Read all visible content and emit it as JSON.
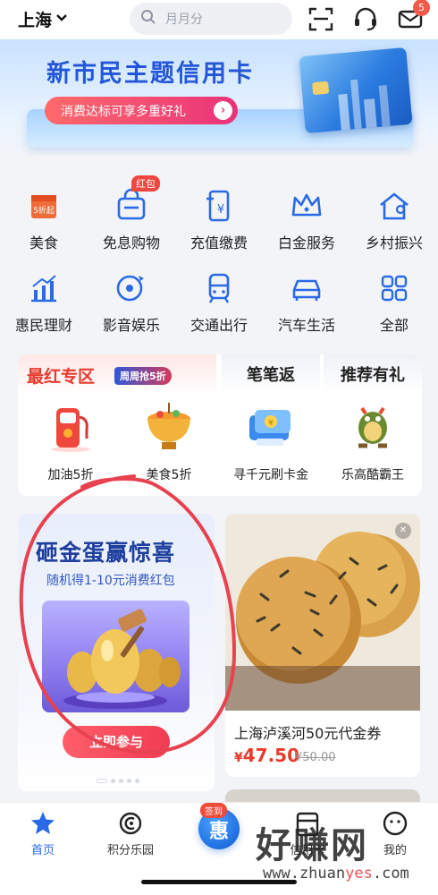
{
  "header": {
    "city": "上海",
    "search_placeholder": "月月分",
    "message_count": "5",
    "icons": [
      "chevron-down-icon",
      "search-icon",
      "scan-icon",
      "headset-icon",
      "mail-icon"
    ]
  },
  "banner": {
    "title": "新市民主题信用卡",
    "button": "消费达标可享多重好礼",
    "button_icon": "chevron-right-icon"
  },
  "grid": [
    {
      "label": "美食",
      "icon": "food-coupon-icon",
      "badge": "5折起"
    },
    {
      "label": "免息购物",
      "icon": "shopping-basket-icon",
      "badge": "红包"
    },
    {
      "label": "充值缴费",
      "icon": "recharge-icon"
    },
    {
      "label": "白金服务",
      "icon": "crown-icon"
    },
    {
      "label": "乡村振兴",
      "icon": "village-house-icon"
    },
    {
      "label": "惠民理财",
      "icon": "finance-chart-icon"
    },
    {
      "label": "影音娱乐",
      "icon": "media-icon"
    },
    {
      "label": "交通出行",
      "icon": "train-icon"
    },
    {
      "label": "汽车生活",
      "icon": "car-icon"
    },
    {
      "label": "全部",
      "icon": "all-apps-icon"
    }
  ],
  "promo": {
    "hot_title": "最红专区",
    "hot_tag": "周周抢5折",
    "tab2": "笔笔返",
    "tab3": "推荐有礼",
    "items": [
      {
        "label": "加油5折",
        "icon": "fuel-pump-icon"
      },
      {
        "label": "美食5折",
        "icon": "hotpot-icon"
      },
      {
        "label": "寻千元刷卡金",
        "icon": "gift-card-icon"
      },
      {
        "label": "乐高酷霸王",
        "icon": "lego-bowser-icon"
      }
    ]
  },
  "egg_card": {
    "title": "砸金蛋赢惊喜",
    "subtitle": "随机得1-10元消费红包",
    "button": "立即参与"
  },
  "food_card": {
    "title": "上海泸溪河50元代金券",
    "price_symbol": "¥",
    "price": "47.50",
    "old_price": "¥50.00"
  },
  "nav": [
    {
      "label": "首页",
      "icon": "home-star-icon",
      "active": true
    },
    {
      "label": "积分乐园",
      "icon": "points-icon"
    },
    {
      "label": "签到",
      "icon": "sign-in-icon"
    },
    {
      "label": "信用卡",
      "icon": "credit-card-icon"
    },
    {
      "label": "我的",
      "icon": "profile-icon"
    }
  ],
  "watermark": {
    "text": "好赚网",
    "url_part1": "www.zhuan",
    "url_part2": "yes",
    "url_part3": ".com"
  },
  "colors": {
    "brand_blue": "#2a6ae6",
    "accent_red": "#e8392d",
    "annotation_red": "#e8414f"
  }
}
